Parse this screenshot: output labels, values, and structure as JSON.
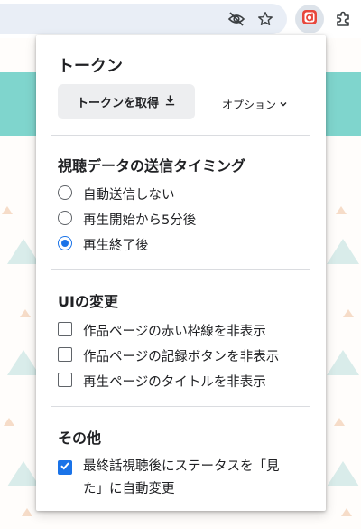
{
  "popup": {
    "title": "トークン",
    "get_token_button": "トークンを取得",
    "options_link": "オプション",
    "sections": [
      {
        "title": "視聴データの送信タイミング",
        "radios": [
          {
            "label": "自動送信しない",
            "selected": false
          },
          {
            "label": "再生開始から5分後",
            "selected": false
          },
          {
            "label": "再生終了後",
            "selected": true
          }
        ]
      },
      {
        "title": "UIの変更",
        "checks": [
          {
            "label": "作品ページの赤い枠線を非表示",
            "checked": false
          },
          {
            "label": "作品ページの記録ボタンを非表示",
            "checked": false
          },
          {
            "label": "再生ページのタイトルを非表示",
            "checked": false
          }
        ]
      },
      {
        "title": "その他",
        "checks": [
          {
            "label_line1": "最終話視聴後にステータスを「見",
            "label_line2": "た」に自動変更",
            "checked": true
          }
        ]
      }
    ]
  },
  "colors": {
    "accent": "#1a73e8",
    "teal_band": "#7fd5cd",
    "extension_icon": "#e8473c"
  }
}
